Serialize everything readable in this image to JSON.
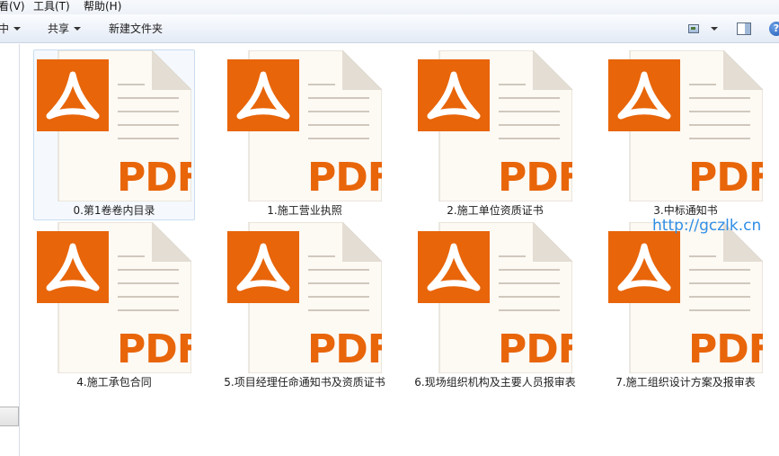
{
  "menu": {
    "view_fragment": "看(V)",
    "tools": "工具(T)",
    "help": "帮助(H)"
  },
  "toolbar": {
    "include_fragment": "中",
    "share_label": "共享",
    "new_folder_label": "新建文件夹"
  },
  "icons": {
    "view": "view-toggle-icon",
    "preview_pane": "preview-pane-icon",
    "help": "help-icon",
    "file": "pdf-file-icon"
  },
  "colors": {
    "pdf_orange": "#e8650a",
    "page_background": "#fdf9f3",
    "page_fold": "#e3ddd4",
    "watermark": "#2f8ee6"
  },
  "pdf_badge_text": "PDF",
  "files": [
    {
      "name": "0.第1卷卷内目录",
      "selected": true
    },
    {
      "name": "1.施工营业执照",
      "selected": false
    },
    {
      "name": "2.施工单位资质证书",
      "selected": false
    },
    {
      "name": "3.中标通知书",
      "selected": false
    },
    {
      "name": "4.施工承包合同",
      "selected": false
    },
    {
      "name": "5.项目经理任命通知书及资质证书",
      "selected": false
    },
    {
      "name": "6.现场组织机构及主要人员报审表",
      "selected": false
    },
    {
      "name": "7.施工组织设计方案及报审表",
      "selected": false
    }
  ],
  "watermark": "http://gczlk.cn"
}
